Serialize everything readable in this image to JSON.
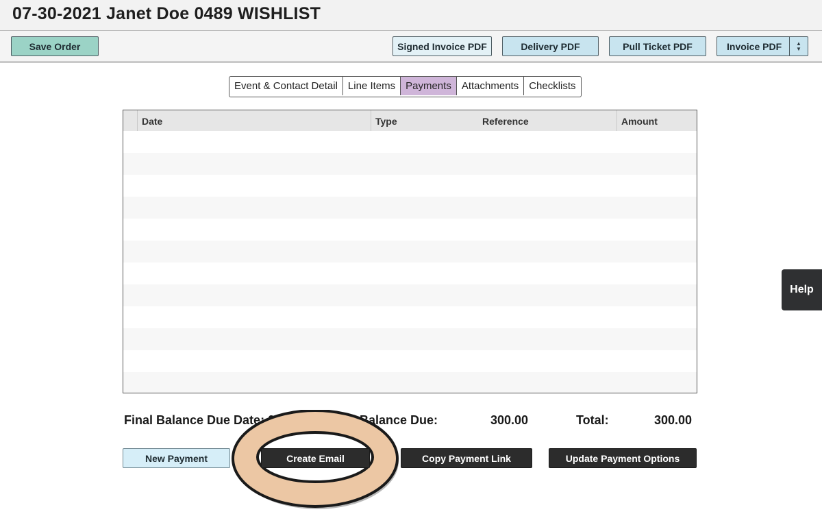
{
  "header": {
    "title": "07-30-2021 Janet Doe 0489 WISHLIST"
  },
  "toolbar": {
    "save_label": "Save Order",
    "signed_invoice_label": "Signed Invoice PDF",
    "delivery_label": "Delivery PDF",
    "pull_ticket_label": "Pull Ticket PDF",
    "invoice_label": "Invoice PDF"
  },
  "tabs": [
    {
      "label": "Event & Contact Detail"
    },
    {
      "label": "Line Items"
    },
    {
      "label": "Payments",
      "active": true
    },
    {
      "label": "Attachments"
    },
    {
      "label": "Checklists"
    }
  ],
  "payments_table": {
    "columns": [
      "Date",
      "Type",
      "Reference",
      "Amount"
    ],
    "rows": []
  },
  "summary": {
    "final_balance_label": "Final Balance Due Date: 0",
    "balance_due_label": "Balance Due:",
    "balance_due_value": "300.00",
    "total_label": "Total:",
    "total_value": "300.00"
  },
  "actions": {
    "new_payment_label": "New Payment",
    "create_email_label": "Create Email",
    "copy_link_label": "Copy Payment Link",
    "update_options_label": "Update Payment Options"
  },
  "help": {
    "label": "Help"
  },
  "colors": {
    "save_button": "#9bd3c6",
    "pdf_button": "#c8e4ef",
    "active_tab": "#cfb5d9",
    "dark_button": "#2c2c2c",
    "highlight_ring": "#ecc7a4"
  }
}
